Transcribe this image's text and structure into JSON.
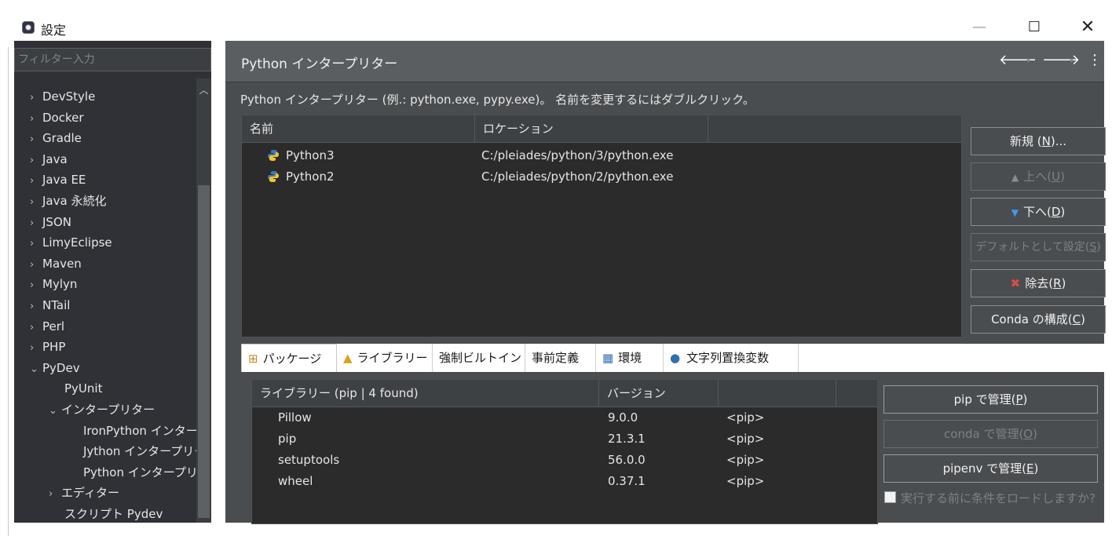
{
  "window": {
    "title": "設定",
    "minimize": "—",
    "maximize": "☐",
    "close": "✕"
  },
  "filter": {
    "placeholder": "フィルター入力"
  },
  "tree": [
    {
      "label": "DevStyle",
      "arrow": "›"
    },
    {
      "label": "Docker",
      "arrow": "›"
    },
    {
      "label": "Gradle",
      "arrow": "›"
    },
    {
      "label": "Java",
      "arrow": "›"
    },
    {
      "label": "Java EE",
      "arrow": "›"
    },
    {
      "label": "Java 永続化",
      "arrow": "›"
    },
    {
      "label": "JSON",
      "arrow": "›"
    },
    {
      "label": "LimyEclipse",
      "arrow": "›"
    },
    {
      "label": "Maven",
      "arrow": "›"
    },
    {
      "label": "Mylyn",
      "arrow": "›"
    },
    {
      "label": "NTail",
      "arrow": "›"
    },
    {
      "label": "Perl",
      "arrow": "›"
    },
    {
      "label": "PHP",
      "arrow": "›"
    },
    {
      "label": "PyDev",
      "arrow": "⌄"
    },
    {
      "label": "PyUnit",
      "arrow": ""
    },
    {
      "label": "インタープリター",
      "arrow": "⌄"
    },
    {
      "label": "IronPython インター",
      "arrow": ""
    },
    {
      "label": "Jython インタープリタ",
      "arrow": ""
    },
    {
      "label": "Python インタープリタ",
      "arrow": ""
    },
    {
      "label": "エディター",
      "arrow": "›"
    },
    {
      "label": "スクリプト Pydev",
      "arrow": ""
    }
  ],
  "page": {
    "title": "Python インタープリター",
    "back": "🡐",
    "forward": "🡒",
    "menu": "⋮",
    "dropdown": "▾",
    "description": "Python インタープリター (例.: python.exe, pypy.exe)。 名前を変更するにはダブルクリック。"
  },
  "interpreters": {
    "columns": [
      "名前",
      "ロケーション",
      ""
    ],
    "rows": [
      {
        "name": "Python3",
        "location": "C:/pleiades/python/3/python.exe"
      },
      {
        "name": "Python2",
        "location": "C:/pleiades/python/2/python.exe"
      }
    ]
  },
  "buttons": {
    "new": {
      "label": "新規 (",
      "key": "N",
      "suffix": ")..."
    },
    "up": {
      "label": "上へ(",
      "key": "U",
      "suffix": ")",
      "icon": "▲"
    },
    "down": {
      "label": "下へ(",
      "key": "D",
      "suffix": ")",
      "icon": "▼"
    },
    "set_default": {
      "label": "デフォルトとして設定(",
      "key": "S",
      "suffix": ")"
    },
    "remove": {
      "label": "除去(",
      "key": "R",
      "suffix": ")",
      "icon": "✖"
    },
    "conda": {
      "label": "Conda の構成(",
      "key": "C",
      "suffix": ")"
    }
  },
  "tabs": [
    {
      "label": "パッケージ",
      "icon": "⊞"
    },
    {
      "label": "ライブラリー",
      "icon": "▲"
    },
    {
      "label": "強制ビルトイン",
      "icon": ""
    },
    {
      "label": "事前定義",
      "icon": ""
    },
    {
      "label": "環境",
      "icon": "▦"
    },
    {
      "label": "文字列置換変数",
      "icon": "●"
    }
  ],
  "libraries": {
    "columns": [
      "ライブラリー (pip | 4 found)",
      "バージョン",
      "",
      ""
    ],
    "rows": [
      {
        "name": "Pillow",
        "version": "9.0.0",
        "source": "<pip>"
      },
      {
        "name": "pip",
        "version": "21.3.1",
        "source": "<pip>"
      },
      {
        "name": "setuptools",
        "version": "56.0.0",
        "source": "<pip>"
      },
      {
        "name": "wheel",
        "version": "0.37.1",
        "source": "<pip>"
      }
    ]
  },
  "manage": {
    "pip": {
      "label": "pip で管理(",
      "key": "P",
      "suffix": ")"
    },
    "conda": {
      "label": "conda で管理(",
      "key": "O",
      "suffix": ")"
    },
    "pipenv": {
      "label": "pipenv で管理(",
      "key": "E",
      "suffix": ")"
    },
    "load_condition": "実行する前に条件をロードしますか?"
  }
}
